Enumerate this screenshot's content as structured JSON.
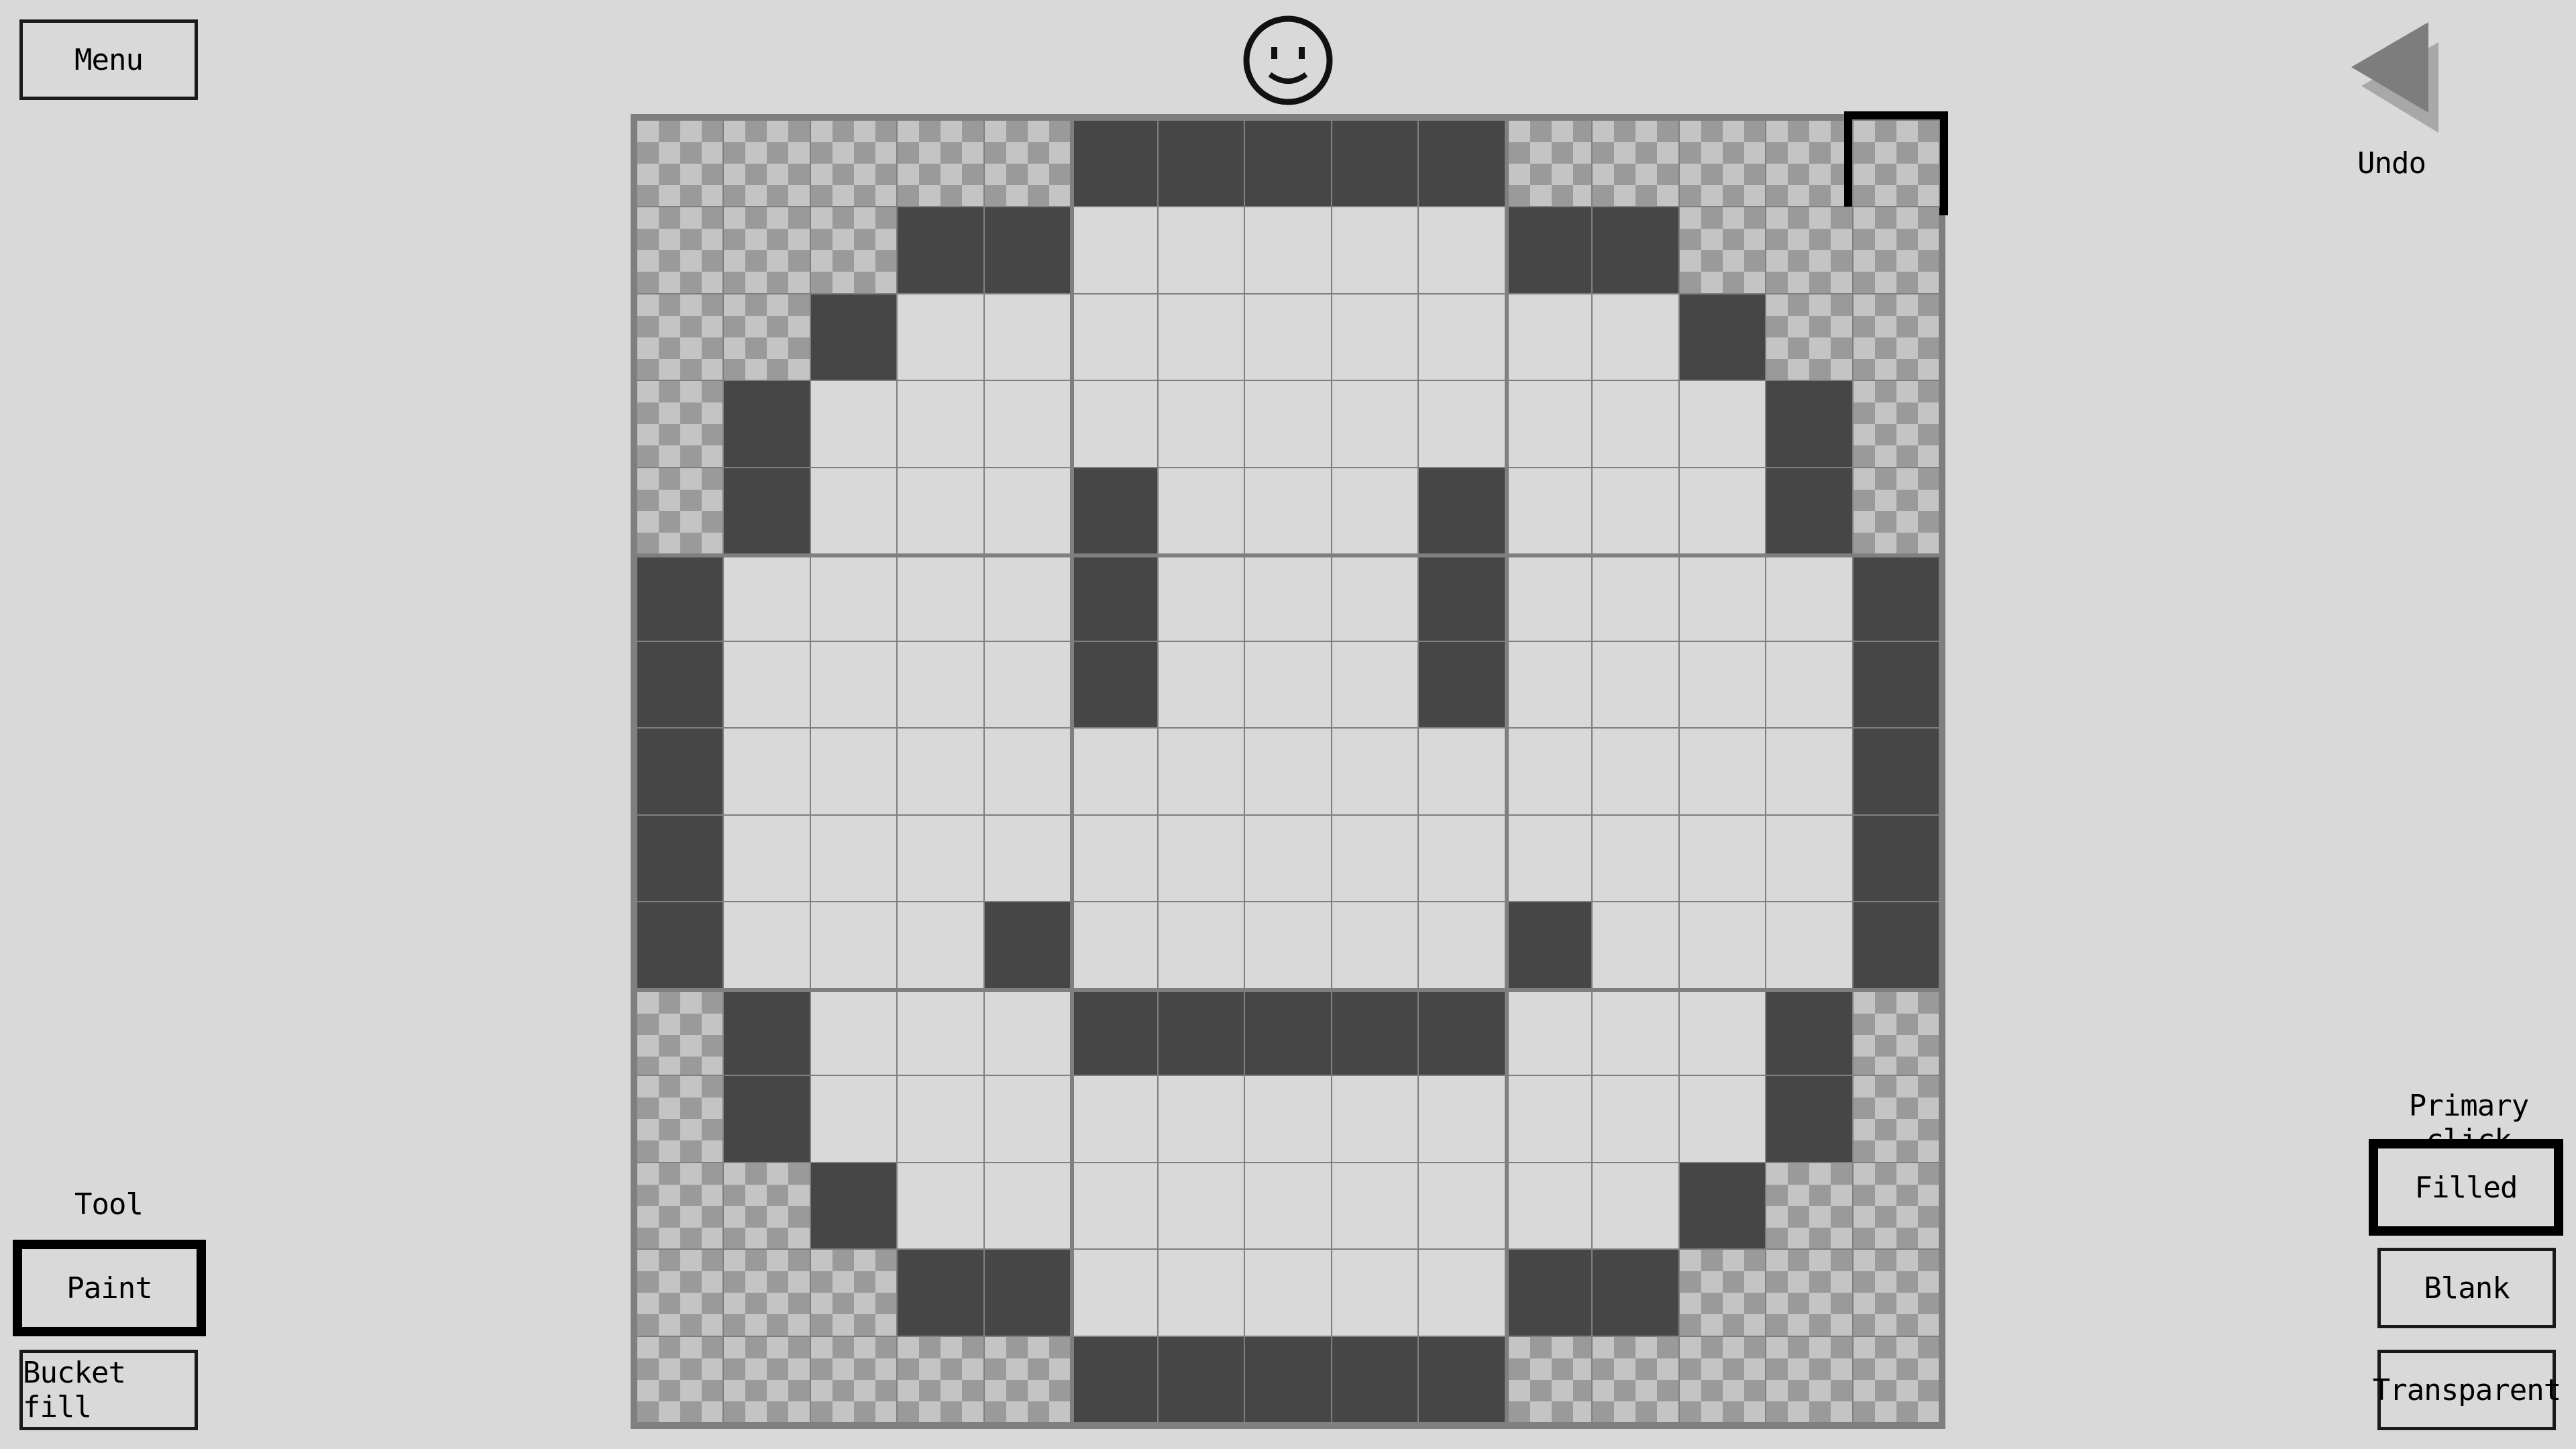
{
  "menu": {
    "label": "Menu"
  },
  "undo": {
    "label": "Undo",
    "icon": "undo-arrow-icon"
  },
  "status": {
    "icon": "smiley-face-icon"
  },
  "tool": {
    "heading": "Tool",
    "options": [
      "Paint",
      "Bucket fill"
    ],
    "selected": "Paint"
  },
  "primary_click": {
    "heading": "Primary click",
    "options": [
      "Filled",
      "Blank",
      "Transparent"
    ],
    "selected": "Filled"
  },
  "canvas": {
    "columns": 15,
    "rows": 15,
    "legend": {
      "F": "filled",
      "B": "blank",
      "T": "transparent"
    },
    "cursor_cell": {
      "row": 0,
      "col": 14
    },
    "cells": [
      "TTTTTFFFFFTTTTT",
      "TTTFFBBBBBFFTTT",
      "TTFBBBBBBBBBFTT",
      "TFBBBBBBBBBBBFT",
      "TFBBBFBBBFBBBFT",
      "FBBBBFBBBFBBBBF",
      "FBBBBFBBBFBBBBF",
      "FBBBBBBBBBBBBBF",
      "FBBBBBBBBBBBBBF",
      "FBBBFBBBBBFBBBF",
      "TFBBBFFFFFBBBFT",
      "TFBBBBBBBBBBBFT",
      "TTFBBBBBBBBBFTT",
      "TTTFFBBBBBFFTTT",
      "TTTTTFFFFFTTTTT"
    ],
    "colors": {
      "filled": "#464646",
      "blank": "#d9d9d9",
      "transparent_light": "#c4c4c4",
      "transparent_dark": "#9a9a9a",
      "grid_line": "#7f7f7f"
    }
  }
}
